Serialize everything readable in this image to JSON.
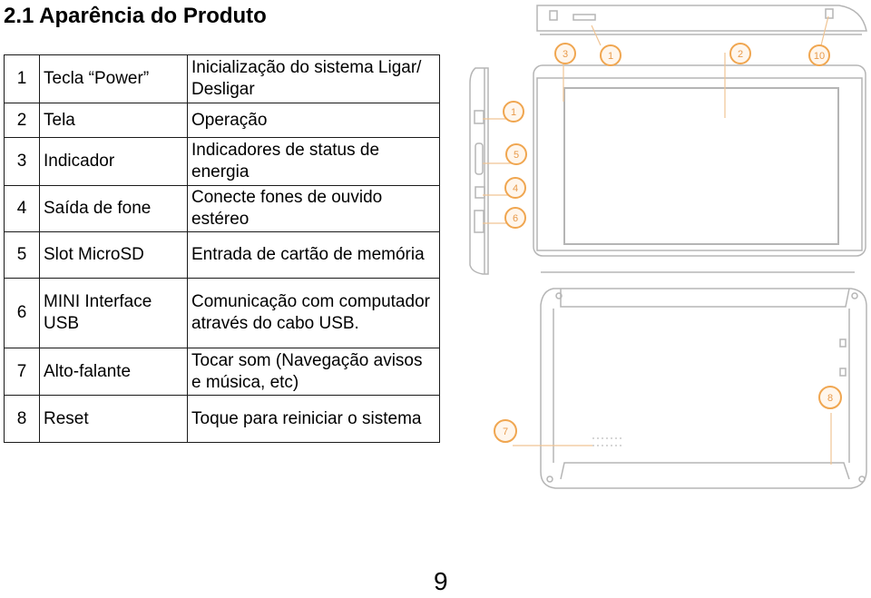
{
  "page": {
    "title": "2.1 Aparência do Produto",
    "page_number": "9"
  },
  "parts_table": {
    "rows": [
      {
        "num": "1",
        "name": "Tecla “Power”",
        "desc": "Inicialização do sistema Ligar/ Desligar"
      },
      {
        "num": "2",
        "name": "Tela",
        "desc": "Operação"
      },
      {
        "num": "3",
        "name": "Indicador",
        "desc": "Indicadores de status de energia"
      },
      {
        "num": "4",
        "name": "Saída de fone",
        "desc": "Conecte fones de ouvido estéreo"
      },
      {
        "num": "5",
        "name": "Slot MicroSD",
        "desc": "Entrada de cartão de memória"
      },
      {
        "num": "6",
        "name": "MINI Interface USB",
        "desc": "Comunicação com computador através do cabo USB."
      },
      {
        "num": "7",
        "name": "Alto-falante",
        "desc": "Tocar som (Navegação avisos e música, etc)"
      },
      {
        "num": "8",
        "name": "Reset",
        "desc": "Toque para reiniciar o sistema"
      }
    ]
  },
  "diagram": {
    "callout_color": "#f0a650",
    "line_color": "#b0b0b0",
    "callouts": {
      "top_1": "3",
      "top_2": "1",
      "top_3": "2",
      "top_4": "10",
      "side_1": "1",
      "side_2": "5",
      "side_3": "4",
      "side_4": "6",
      "back_1": "7",
      "back_2": "8"
    }
  }
}
